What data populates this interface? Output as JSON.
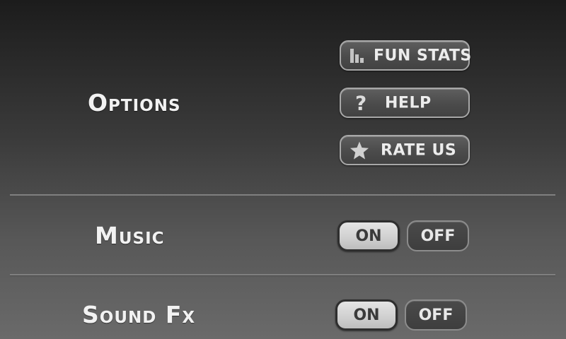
{
  "options": {
    "label": "Options",
    "buttons": [
      {
        "label": "FUN STATS",
        "icon": "bar-chart-icon"
      },
      {
        "label": "HELP",
        "icon": "question-mark-icon",
        "glyph": "?"
      },
      {
        "label": "RATE US",
        "icon": "star-icon"
      }
    ]
  },
  "music": {
    "label": "Music",
    "on_label": "ON",
    "off_label": "OFF",
    "state": "on"
  },
  "sound_fx": {
    "label": "Sound Fx",
    "on_label": "ON",
    "off_label": "OFF",
    "state": "on"
  },
  "colors": {
    "background_top": "#1c1c1c",
    "background_bottom": "#6a6a6a",
    "text": "#f2f2f2",
    "toggle_selected": "#d6d6d6",
    "toggle_unselected": "#444444"
  }
}
